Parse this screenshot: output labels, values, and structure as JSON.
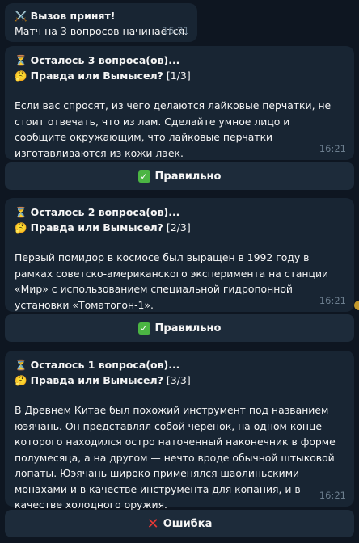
{
  "intro": {
    "icon": "crossed-swords-icon",
    "title": "Вызов принят!",
    "subtitle": "Матч на 3 вопросов начинается.",
    "time": "16:21"
  },
  "questions": [
    {
      "remaining": "Осталось 3 вопроса(ов)...",
      "header": "Правда или Вымысел?",
      "counter": "[1/3]",
      "text": "Если вас спросят, из чего делаются лайковые перчатки, не стоит отвечать, что из лам. Сделайте умное лицо и сообщите окружающим, что лайковые перчатки изготавливаются из кожи лаек.",
      "time": "16:21",
      "answer": "Правильно",
      "answer_icon": "check-mark-icon"
    },
    {
      "remaining": "Осталось 2 вопроса(ов)...",
      "header": "Правда или Вымысел?",
      "counter": "[2/3]",
      "text": "Первый помидор в космосе был выращен в 1992 году в рамках советско-американского эксперимента на станции «Мир» с использованием специальной гидропонной установки «Томатогон-1».",
      "time": "16:21",
      "answer": "Правильно",
      "answer_icon": "check-mark-icon"
    },
    {
      "remaining": "Осталось 1 вопроса(ов)...",
      "header": "Правда или Вымысел?",
      "counter": "[3/3]",
      "text": "В Древнем Китае был похожий инструмент под названием юэячань. Он представлял собой черенок, на одном конце которого находился остро наточенный наконечник в форме полумесяца, а на другом — нечто вроде обычной штыковой лопаты. Юэячань широко применялся шаолиньскими монахами и в качестве инструмента для копания, и в качестве холодного оружия.",
      "time": "16:21",
      "answer": "Ошибка",
      "answer_icon": "cross-mark-icon"
    }
  ]
}
